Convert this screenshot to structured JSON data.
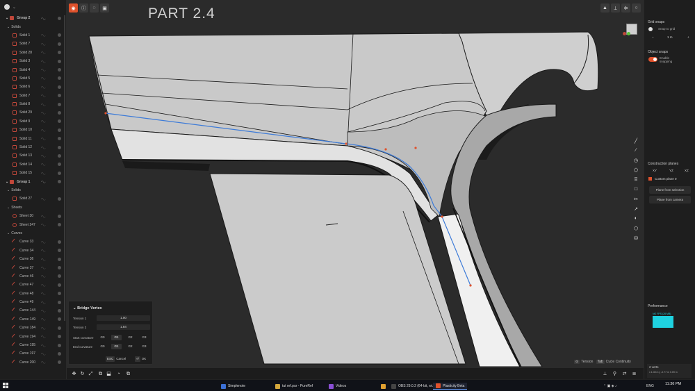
{
  "viewport_title": "PART 2.4",
  "outliner": {
    "rows": [
      {
        "label": "Group 2",
        "kind": "group"
      },
      {
        "label": "Solids",
        "kind": "section"
      },
      {
        "label": "Solid 1",
        "kind": "solid"
      },
      {
        "label": "Solid 7",
        "kind": "solid"
      },
      {
        "label": "Solid 28",
        "kind": "solid"
      },
      {
        "label": "Solid 3",
        "kind": "solid"
      },
      {
        "label": "Solid 4",
        "kind": "solid"
      },
      {
        "label": "Solid 5",
        "kind": "solid"
      },
      {
        "label": "Solid 6",
        "kind": "solid"
      },
      {
        "label": "Solid 7",
        "kind": "solid"
      },
      {
        "label": "Solid 8",
        "kind": "solid"
      },
      {
        "label": "Solid 29",
        "kind": "solid"
      },
      {
        "label": "Solid 9",
        "kind": "solid"
      },
      {
        "label": "Solid 10",
        "kind": "solid"
      },
      {
        "label": "Solid 11",
        "kind": "solid"
      },
      {
        "label": "Solid 12",
        "kind": "solid"
      },
      {
        "label": "Solid 13",
        "kind": "solid"
      },
      {
        "label": "Solid 14",
        "kind": "solid"
      },
      {
        "label": "Solid 15",
        "kind": "solid"
      },
      {
        "label": "Group 1",
        "kind": "group"
      },
      {
        "label": "Solids",
        "kind": "section"
      },
      {
        "label": "Solid 27",
        "kind": "solid"
      },
      {
        "label": "Sheets",
        "kind": "section"
      },
      {
        "label": "Sheet 30",
        "kind": "sheet"
      },
      {
        "label": "Sheet 247",
        "kind": "sheet"
      },
      {
        "label": "Curves",
        "kind": "section"
      },
      {
        "label": "Curve 33",
        "kind": "curve"
      },
      {
        "label": "Curve 34",
        "kind": "curve"
      },
      {
        "label": "Curve 36",
        "kind": "curve"
      },
      {
        "label": "Curve 37",
        "kind": "curve"
      },
      {
        "label": "Curve 46",
        "kind": "curve"
      },
      {
        "label": "Curve 47",
        "kind": "curve"
      },
      {
        "label": "Curve 48",
        "kind": "curve"
      },
      {
        "label": "Curve 49",
        "kind": "curve"
      },
      {
        "label": "Curve 144",
        "kind": "curve"
      },
      {
        "label": "Curve 149",
        "kind": "curve"
      },
      {
        "label": "Curve 184",
        "kind": "curve"
      },
      {
        "label": "Curve 194",
        "kind": "curve"
      },
      {
        "label": "Curve 195",
        "kind": "curve"
      },
      {
        "label": "Curve 197",
        "kind": "curve"
      },
      {
        "label": "Curve 200",
        "kind": "curve"
      }
    ]
  },
  "bridge": {
    "title": "Bridge Vertex",
    "tension1_label": "Tension 1",
    "tension1_value": "1.00",
    "tension2_label": "Tension 2",
    "tension2_value": "1.84",
    "start_label": "Start curvature",
    "end_label": "End curvature",
    "g0": "G0",
    "g1": "G1",
    "g2": "G2",
    "g3": "G3",
    "esc_key": "ESC",
    "cancel": "Cancel",
    "ok_key": "⏎",
    "ok": "OK"
  },
  "hints": {
    "tension_key": "⊙",
    "tension": "Tension",
    "tab_key": "Tab",
    "cycle": "Cycle Continuity"
  },
  "rightpanel": {
    "grid_snaps": "Grid snaps",
    "snap_to_grid": "Snap to grid",
    "grid_minus": "−",
    "grid_value": "1 m",
    "grid_plus": "+",
    "object_snaps": "Object snaps",
    "enable_snapping": "Enable snapping",
    "construction_planes": "Construction planes",
    "xy": "XY",
    "yz": "YZ",
    "xz": "XZ",
    "custom_plane": "Custom plane 0",
    "plane_from_selection": "Plane from selection",
    "plane_from_camera": "Plane from camera",
    "performance": "Performance",
    "fps": "NO FPS (26 MB)",
    "status_count": "2 verts",
    "status_coords": "x 1.08 m   y -0.77 m   0.09 m"
  },
  "taskbar": {
    "apps": [
      {
        "label": "Simplenote",
        "color": "#3b6fd4"
      },
      {
        "label": "tut ref.pur - PureRef",
        "color": "#d4a73b"
      },
      {
        "label": "Videos",
        "color": "#8a4fd4"
      },
      {
        "label": "",
        "color": "#e0a030"
      },
      {
        "label": "OBS 29.0.2 (64-bit, wi...",
        "color": "#444"
      },
      {
        "label": "Plasticity Beta",
        "color": "#e0522c"
      }
    ],
    "lang": "ENG",
    "time": "11:36 PM"
  },
  "colors": {
    "accent": "#e0522c",
    "curve": "#3d7bd8",
    "perf": "#1fd2e0"
  }
}
